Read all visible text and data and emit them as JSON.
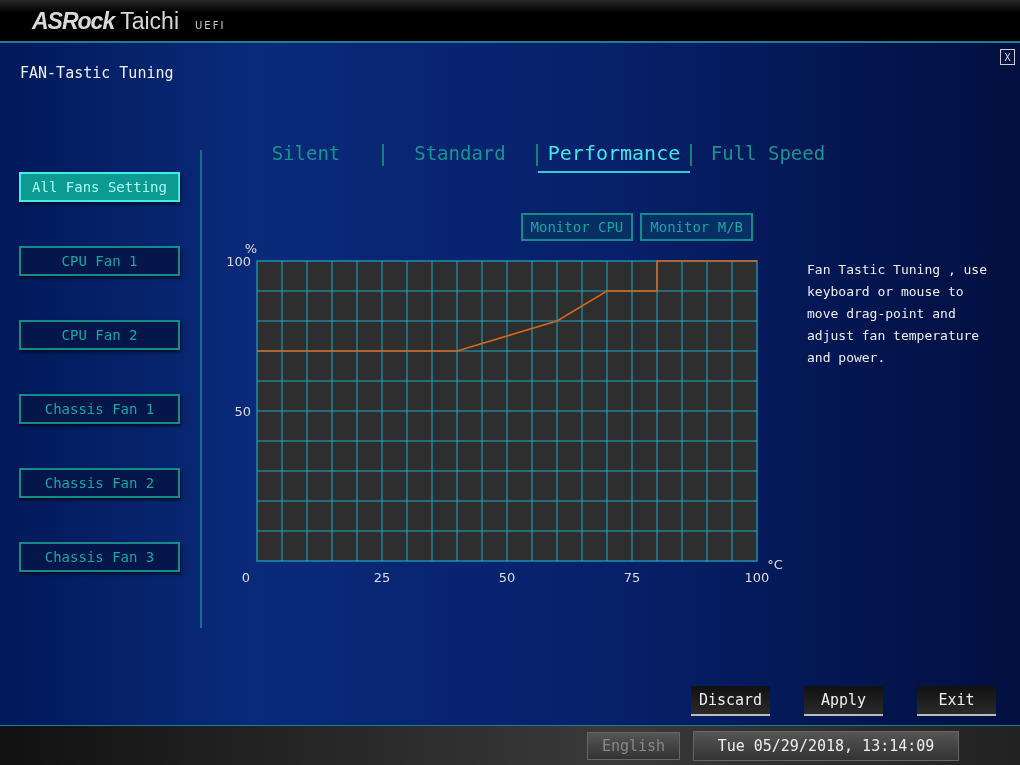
{
  "header": {
    "brand": "ASRock",
    "model": "Taichi",
    "tag": "UEFI"
  },
  "close_button": "X",
  "page_title": "FAN-Tastic Tuning",
  "fans": [
    {
      "label": "All Fans Setting",
      "selected": true
    },
    {
      "label": "CPU Fan 1",
      "selected": false
    },
    {
      "label": "CPU Fan 2",
      "selected": false
    },
    {
      "label": "Chassis Fan 1",
      "selected": false
    },
    {
      "label": "Chassis Fan 2",
      "selected": false
    },
    {
      "label": "Chassis Fan 3",
      "selected": false
    }
  ],
  "modes": [
    {
      "label": "Silent",
      "selected": false
    },
    {
      "label": "Standard",
      "selected": false
    },
    {
      "label": "Performance",
      "selected": true
    },
    {
      "label": "Full Speed",
      "selected": false
    }
  ],
  "monitor_buttons": [
    "Monitor CPU",
    "Monitor M/B"
  ],
  "chart": {
    "chart_data": {
      "type": "line",
      "xlabel": "°C",
      "ylabel": "%",
      "x": [
        0,
        40,
        60,
        70,
        80,
        80,
        100
      ],
      "grid": true,
      "series": [
        {
          "color": "#d8661a",
          "values": [
            70,
            70,
            80,
            90,
            90,
            100,
            100
          ]
        }
      ],
      "xlim": [
        0,
        100
      ],
      "ylim": [
        0,
        100
      ],
      "xticks": [
        0,
        25,
        50,
        75,
        100
      ],
      "yticks": [
        50,
        100
      ]
    }
  },
  "description": "Fan Tastic Tuning , use keyboard or mouse to move drag-point and adjust fan temperature and power.",
  "actions": [
    "Discard",
    "Apply",
    "Exit"
  ],
  "status_bar": {
    "language": "English",
    "datetime": "Tue 05/29/2018, 13:14:09"
  }
}
